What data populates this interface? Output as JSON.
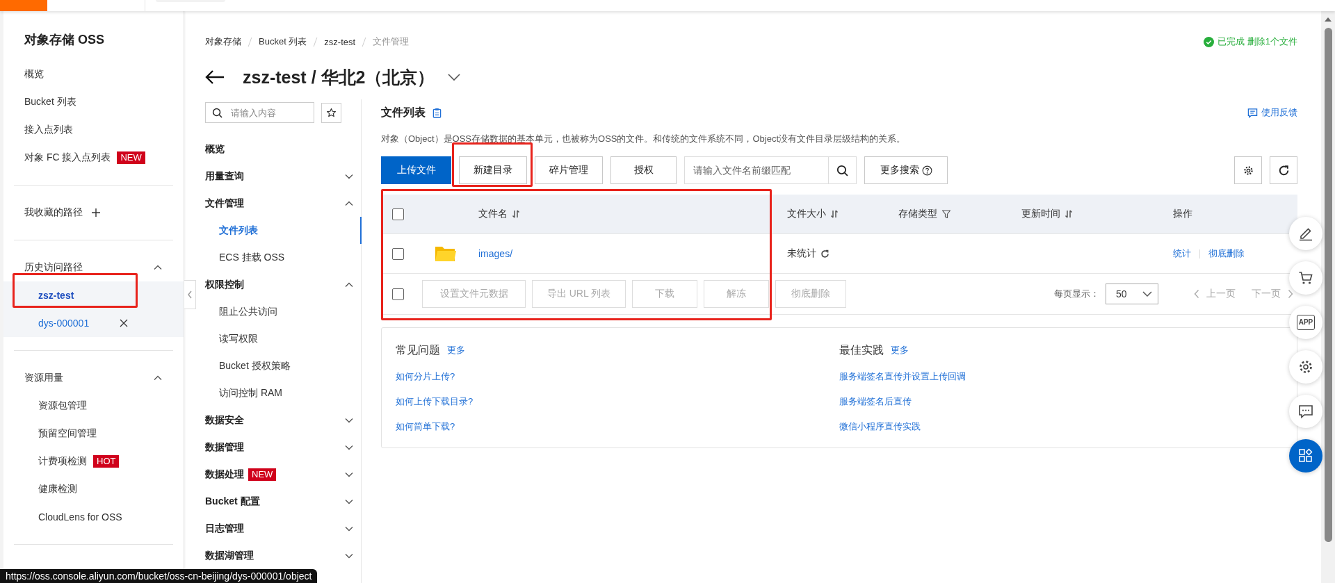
{
  "sidebar": {
    "title": "对象存储 OSS",
    "links": [
      {
        "label": "概览"
      },
      {
        "label": "Bucket 列表"
      },
      {
        "label": "接入点列表"
      },
      {
        "label": "对象 FC 接入点列表",
        "badge": "NEW"
      }
    ],
    "favorites": {
      "title": "我收藏的路径"
    },
    "history": {
      "title": "历史访问路径",
      "expanded": true,
      "items": [
        {
          "label": "zsz-test",
          "selected": true,
          "annotated": true
        },
        {
          "label": "dys-000001",
          "selected": false,
          "annotated": false
        }
      ]
    },
    "resources": {
      "title": "资源用量",
      "expanded": true,
      "items": [
        {
          "label": "资源包管理"
        },
        {
          "label": "预留空间管理"
        },
        {
          "label": "计费项检测",
          "badge": "HOT"
        },
        {
          "label": "健康检测"
        },
        {
          "label": "CloudLens for OSS"
        }
      ]
    }
  },
  "breadcrumb": [
    {
      "label": "对象存储",
      "current": false
    },
    {
      "label": "Bucket 列表",
      "current": false
    },
    {
      "label": "zsz-test",
      "current": false
    },
    {
      "label": "文件管理",
      "current": true
    }
  ],
  "page_title": "zsz-test / 华北2（北京）",
  "status": "已完成 删除1个文件",
  "nav": {
    "search_placeholder": "请输入内容",
    "items": [
      {
        "label": "概览"
      },
      {
        "label": "用量查询",
        "expanded": false
      },
      {
        "label": "文件管理",
        "expanded": true,
        "children": [
          {
            "label": "文件列表",
            "selected": true
          },
          {
            "label": "ECS 挂载 OSS",
            "selected": false
          }
        ]
      },
      {
        "label": "权限控制",
        "expanded": true,
        "children": [
          {
            "label": "阻止公共访问",
            "selected": false
          },
          {
            "label": "读写权限",
            "selected": false
          },
          {
            "label": "Bucket 授权策略",
            "selected": false
          },
          {
            "label": "访问控制 RAM",
            "selected": false
          }
        ]
      },
      {
        "label": "数据安全",
        "expanded": false
      },
      {
        "label": "数据管理",
        "expanded": false
      },
      {
        "label": "数据处理",
        "expanded": false,
        "badge": "NEW"
      },
      {
        "label": "Bucket 配置",
        "expanded": false
      },
      {
        "label": "日志管理",
        "expanded": false
      },
      {
        "label": "数据湖管理",
        "expanded": false
      }
    ]
  },
  "section_title": "文件列表",
  "feedback": "使用反馈",
  "description": "对象（Object）是OSS存储数据的基本单元，也被称为OSS的文件。和传统的文件系统不同，Object没有文件目录层级结构的关系。",
  "toolbar": {
    "buttons": [
      {
        "label": "上传文件",
        "kind": "primary",
        "annotated": false
      },
      {
        "label": "新建目录",
        "kind": "default",
        "annotated": true
      },
      {
        "label": "碎片管理",
        "kind": "default",
        "annotated": false
      },
      {
        "label": "授权",
        "kind": "default",
        "annotated": false
      }
    ],
    "search_placeholder": "请输入文件名前缀匹配",
    "more_search": "更多搜索"
  },
  "table": {
    "annotated": true,
    "select_all_checked": false,
    "columns": [
      {
        "label": "文件名",
        "kind": "sort"
      },
      {
        "label": "文件大小",
        "kind": "sort"
      },
      {
        "label": "存储类型",
        "kind": "filter"
      },
      {
        "label": "更新时间",
        "kind": "sort"
      },
      {
        "label": "操作",
        "kind": "plain"
      }
    ],
    "rows": [
      {
        "name": "images/",
        "kind": "folder",
        "checked": false,
        "size": "未统计",
        "actions": [
          "统计",
          "彻底删除"
        ]
      }
    ],
    "bulk_checked": false,
    "bulk_actions": [
      {
        "label": "设置文件元数据",
        "disabled": true
      },
      {
        "label": "导出 URL 列表",
        "disabled": true
      },
      {
        "label": "下载",
        "disabled": true
      },
      {
        "label": "解冻",
        "disabled": true
      },
      {
        "label": "彻底删除",
        "disabled": true
      }
    ],
    "page_size_label": "每页显示：",
    "page_size": "50",
    "prev": {
      "label": "上一页",
      "disabled": true
    },
    "next": {
      "label": "下一页",
      "disabled": true
    }
  },
  "help": [
    {
      "title": "常见问题",
      "more": "更多",
      "links": [
        "如何分片上传?",
        "如何上传下载目录?",
        "如何简单下载?"
      ]
    },
    {
      "title": "最佳实践",
      "more": "更多",
      "links": [
        "服务端签名直传并设置上传回调",
        "服务端签名后直传",
        "微信小程序直传实践"
      ]
    }
  ],
  "float_tools": [
    {
      "kind": "edit",
      "selected": false
    },
    {
      "kind": "cart",
      "selected": false
    },
    {
      "kind": "app",
      "label": "APP",
      "selected": false
    },
    {
      "kind": "settings",
      "selected": false
    },
    {
      "kind": "chat",
      "selected": false
    },
    {
      "kind": "apps",
      "selected": true
    }
  ],
  "tooltip": "https://oss.console.aliyun.com/bucket/oss-cn-beijing/dys-000001/object"
}
